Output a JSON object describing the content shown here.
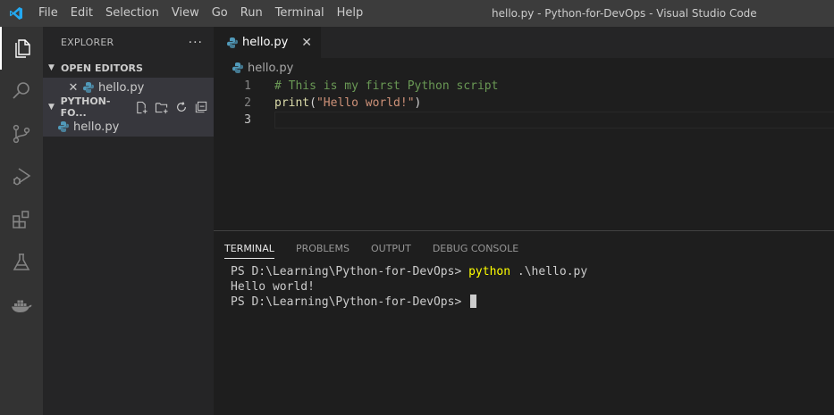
{
  "titlebar": {
    "menu": [
      "File",
      "Edit",
      "Selection",
      "View",
      "Go",
      "Run",
      "Terminal",
      "Help"
    ],
    "window_title": "hello.py - Python-for-DevOps - Visual Studio Code"
  },
  "activitybar": {
    "icons": [
      "explorer-icon",
      "search-icon",
      "source-control-icon",
      "run-debug-icon",
      "extensions-icon",
      "testing-icon",
      "docker-icon"
    ]
  },
  "sidebar": {
    "title": "EXPLORER",
    "more": "···",
    "open_editors": {
      "label": "OPEN EDITORS",
      "items": [
        {
          "name": "hello.py"
        }
      ]
    },
    "project": {
      "label": "PYTHON-FO...",
      "files": [
        {
          "name": "hello.py"
        }
      ]
    }
  },
  "editor": {
    "tab": {
      "label": "hello.py",
      "close": "✕"
    },
    "breadcrumb": "hello.py",
    "lines": [
      {
        "num": "1",
        "comment": "# This is my first Python script"
      },
      {
        "num": "2",
        "fn": "print",
        "open": "(",
        "str": "\"Hello world!\"",
        "close": ")"
      },
      {
        "num": "3"
      }
    ]
  },
  "panel": {
    "tabs": [
      "TERMINAL",
      "PROBLEMS",
      "OUTPUT",
      "DEBUG CONSOLE"
    ],
    "terminal": {
      "line1_prompt": "PS D:\\Learning\\Python-for-DevOps> ",
      "line1_cmd": "python",
      "line1_args": " .\\hello.py",
      "line2": "Hello world!",
      "line3_prompt": "PS D:\\Learning\\Python-for-DevOps> "
    }
  },
  "colors": {
    "titlebar_bg": "#3c3c3c",
    "activitybar_bg": "#333333",
    "sidebar_bg": "#252526",
    "editor_bg": "#1e1e1e",
    "vscode_blue": "#23a9f2",
    "python_blue": "#519aba"
  }
}
